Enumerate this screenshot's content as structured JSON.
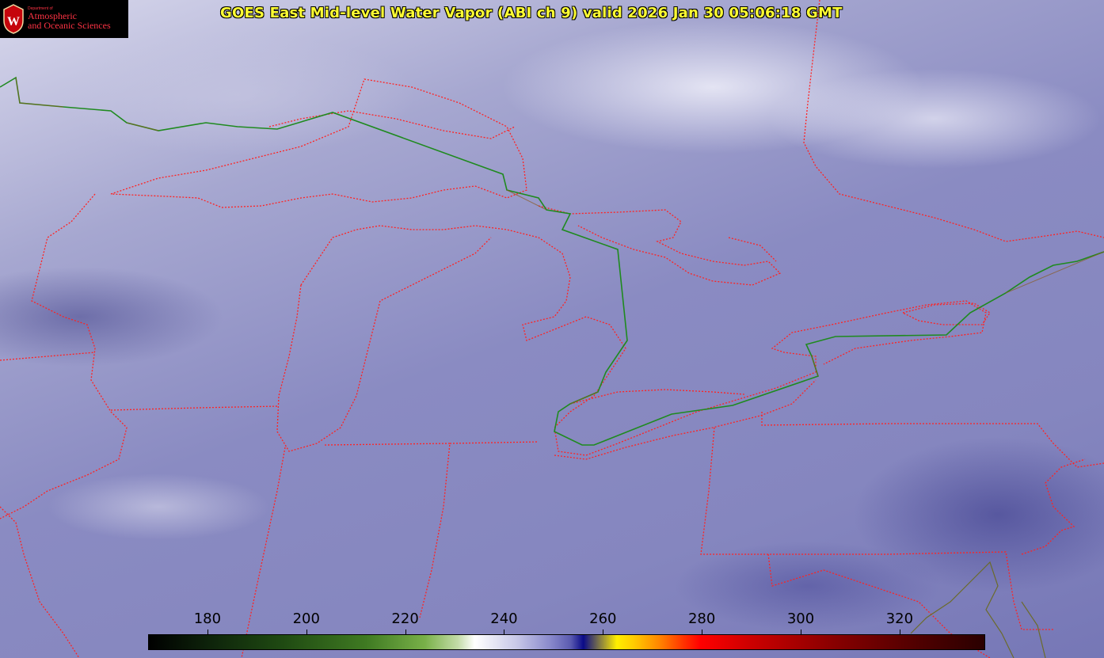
{
  "title": "GOES East Mid-level Water Vapor (ABI ch 9)  valid 2026 Jan 30 05:06:18 GMT",
  "logo": {
    "dept": "Department of",
    "line1": "Atmospheric",
    "line2": "and Oceanic Sciences",
    "crest_letter": "W"
  },
  "colorbar": {
    "ticks": [
      "180",
      "200",
      "220",
      "240",
      "260",
      "280",
      "300",
      "320"
    ],
    "min": 168,
    "max": 337
  },
  "colors": {
    "title": "#ffff33",
    "state_borders": "#ff2222",
    "international_border": "#1f8a1f",
    "logo_text": "#ff3344"
  }
}
